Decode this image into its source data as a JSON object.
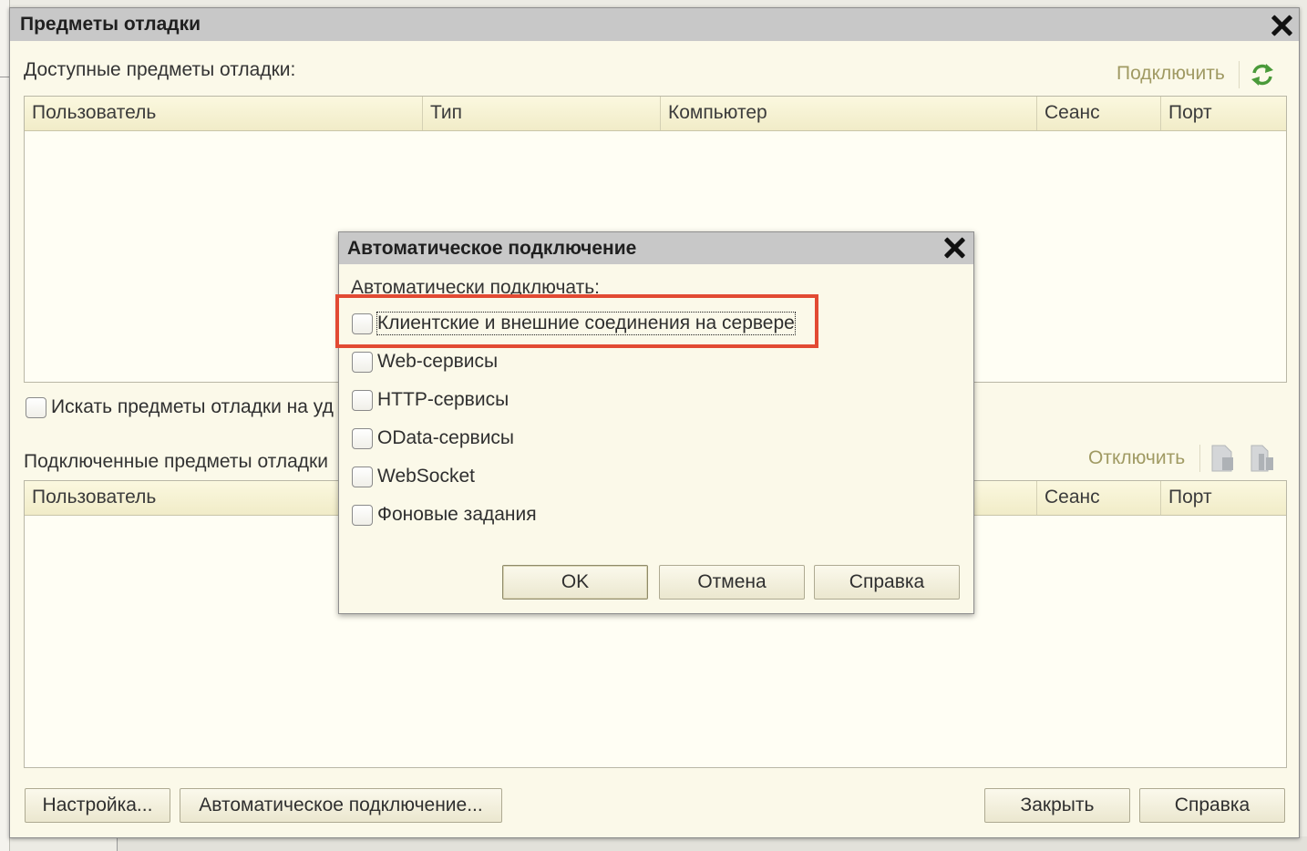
{
  "main_window": {
    "title": "Предметы отладки",
    "available_label": "Доступные предметы отладки:",
    "connect_link": "Подключить",
    "available_columns": [
      "Пользователь",
      "Тип",
      "Компьютер",
      "Сеанс",
      "Порт"
    ],
    "search_remote_label": "Искать предметы отладки на уд",
    "connected_label": "Подключенные предметы отладки",
    "disconnect_link": "Отключить",
    "connected_columns": [
      "Пользователь",
      "Сеанс",
      "Порт"
    ],
    "buttons": {
      "settings": "Настройка...",
      "auto_connect": "Автоматическое подключение...",
      "close": "Закрыть",
      "help": "Справка"
    }
  },
  "modal": {
    "title": "Автоматическое подключение",
    "prompt": "Автоматически подключать:",
    "options": [
      "Клиентские и внешние соединения на сервере",
      "Web-сервисы",
      "HTTP-сервисы",
      "OData-сервисы",
      "WebSocket",
      "Фоновые задания"
    ],
    "buttons": {
      "ok": "OK",
      "cancel": "Отмена",
      "help": "Справка"
    }
  },
  "colors": {
    "title_bar": "#c8c8c8",
    "window_bg": "#fbf9e9",
    "link": "#a09a63",
    "highlight": "#e24a33",
    "refresh_icon": "#4a9a3a"
  }
}
